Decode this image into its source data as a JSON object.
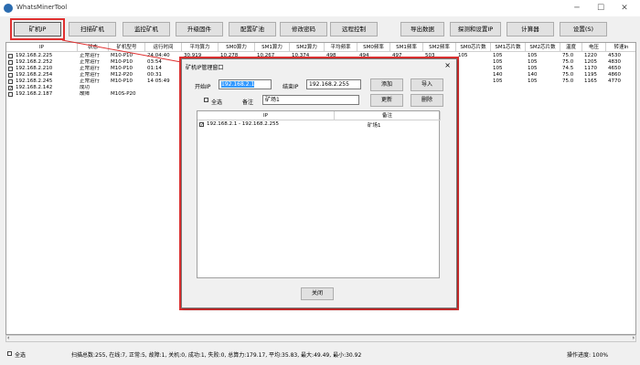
{
  "window": {
    "title": "WhatsMinerTool",
    "minimize": "─",
    "maximize": "☐",
    "close": "✕"
  },
  "toolbar": {
    "left": [
      "矿机IP",
      "扫描矿机",
      "监控矿机",
      "升级固件",
      "配置矿池",
      "修改密码",
      "远程控制"
    ],
    "right": [
      "导出数据",
      "探测和设置IP",
      "计算器",
      "设置(S)"
    ]
  },
  "table": {
    "headers": [
      "IP",
      "状态",
      "矿机型号",
      "运行时间",
      "平均算力",
      "SM0算力",
      "SM1算力",
      "SM2算力",
      "平均频率",
      "SM0频率",
      "SM1频率",
      "SM2频率",
      "SM0芯片数",
      "SM1芯片数",
      "SM2芯片数",
      "温度",
      "电压",
      "转速In"
    ],
    "rows": [
      {
        "checked": false,
        "cells": [
          "192.168.2.225",
          "正常运行",
          "M10-P10",
          "24 04:40",
          "30.919",
          "10.278",
          "10.267",
          "10.374",
          "498",
          "494",
          "497",
          "503",
          "105",
          "105",
          "105",
          "75.0",
          "1220",
          "4530"
        ]
      },
      {
        "checked": false,
        "cells": [
          "192.168.2.252",
          "正常运行",
          "M10-P10",
          "03:54",
          "",
          "",
          "",
          "",
          "",
          "",
          "",
          "",
          "",
          "105",
          "105",
          "75.0",
          "1205",
          "4830"
        ]
      },
      {
        "checked": false,
        "cells": [
          "192.168.2.210",
          "正常运行",
          "M10-P10",
          "01:14",
          "",
          "",
          "",
          "",
          "",
          "",
          "",
          "",
          "",
          "105",
          "105",
          "74.5",
          "1170",
          "4650"
        ]
      },
      {
        "checked": false,
        "cells": [
          "192.168.2.254",
          "正常运行",
          "M12-P20",
          "00:31",
          "",
          "",
          "",
          "",
          "",
          "",
          "",
          "",
          "",
          "140",
          "140",
          "75.0",
          "1195",
          "4860"
        ]
      },
      {
        "checked": false,
        "cells": [
          "192.168.2.245",
          "正常运行",
          "M10-P10",
          "14 05:49",
          "",
          "",
          "",
          "",
          "",
          "",
          "",
          "",
          "",
          "105",
          "105",
          "75.0",
          "1165",
          "4770"
        ]
      },
      {
        "checked": true,
        "cells": [
          "192.168.2.142",
          "成功",
          "",
          "",
          "",
          "",
          "",
          "",
          "",
          "",
          "",
          "",
          "",
          "",
          "",
          "",
          "",
          ""
        ]
      },
      {
        "checked": false,
        "cells": [
          "192.168.2.187",
          "故障",
          "M10S-P20",
          "",
          "",
          "",
          "",
          "",
          "",
          "",
          "",
          "",
          "",
          "",
          "",
          "",
          "",
          ""
        ]
      }
    ]
  },
  "status": {
    "select_all": "全选",
    "summary": "扫描总数:255, 在线:7, 正常:5, 故障:1, 关机:0, 成功:1, 失败:0, 总算力:179.17, 平均:35.83, 最大:49.49, 最小:30.92",
    "progress": "操作进度: 100%"
  },
  "dialog": {
    "title": "矿机IP管理窗口",
    "close": "×",
    "start_ip_label": "开始IP",
    "start_ip_value": "192.168.2.1",
    "end_ip_label": "结束IP",
    "end_ip_value": "192.168.2.255",
    "add": "添加",
    "import": "导入",
    "select_all": "全选",
    "note_label": "备注",
    "note_value": "矿场1",
    "update": "更新",
    "delete": "删除",
    "list_headers": [
      "IP",
      "备注"
    ],
    "list_rows": [
      {
        "checked": true,
        "ip": "192.168.2.1 - 192.168.2.255",
        "note": "矿场1"
      }
    ],
    "close_button": "关闭"
  }
}
